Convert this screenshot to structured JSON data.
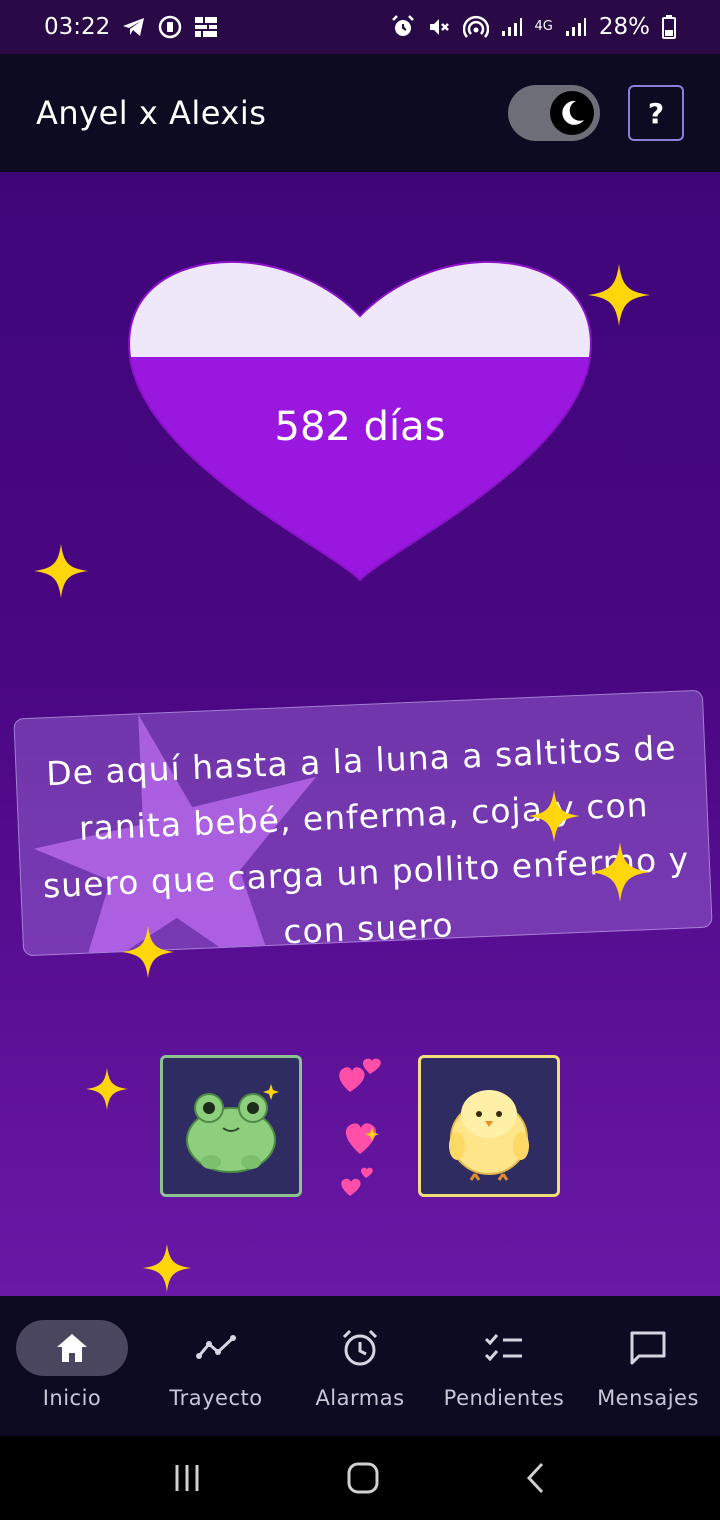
{
  "status_bar": {
    "time": "03:22",
    "network": "4G",
    "battery": "28%"
  },
  "header": {
    "title": "Anyel x Alexis",
    "help_label": "?"
  },
  "heart": {
    "days_label": "582 días",
    "fill_fraction": 0.7,
    "top_color": "#efe8fb",
    "fill_color": "#9a17e0"
  },
  "quote": {
    "text": "De aquí hasta a la luna a saltitos de ranita bebé, enferma, coja y con suero que carga un pollito enfermo y con suero"
  },
  "avatars": {
    "left": "frog",
    "right": "chick"
  },
  "bottom_nav": {
    "items": [
      {
        "label": "Inicio",
        "icon": "home-icon",
        "active": true
      },
      {
        "label": "Trayecto",
        "icon": "trend-line-icon",
        "active": false
      },
      {
        "label": "Alarmas",
        "icon": "alarm-clock-icon",
        "active": false
      },
      {
        "label": "Pendientes",
        "icon": "checklist-icon",
        "active": false
      },
      {
        "label": "Mensajes",
        "icon": "message-icon",
        "active": false
      }
    ]
  },
  "colors": {
    "accent": "#9a17e0",
    "sparkle": "#ffd60a",
    "bar_bg": "#0d0b22"
  }
}
